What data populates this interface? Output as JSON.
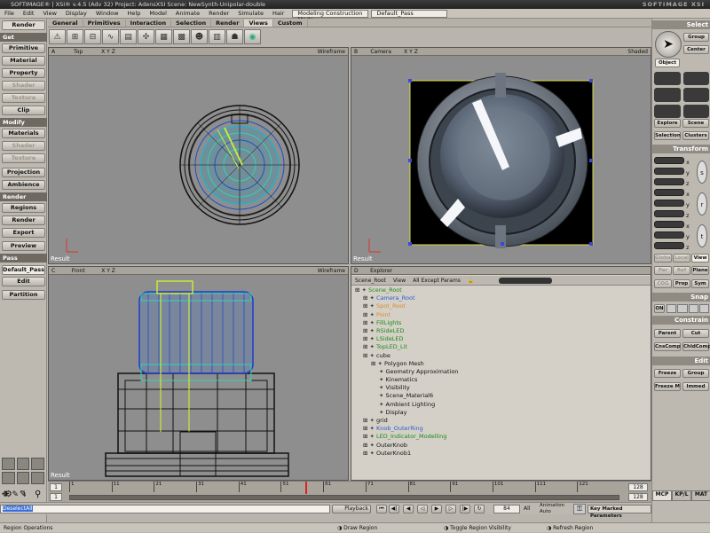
{
  "titlebar": {
    "title": "SOFTIMAGE® | XSI® v.4.5 (Adv 32) Project: AdensXSI    Scene: NewSynth-Unipolar-double",
    "logo": "SOFTIMAGE XSI"
  },
  "menu": {
    "items": [
      "File",
      "Edit",
      "View",
      "Display",
      "Window",
      "Help",
      "Model",
      "Animate",
      "Render",
      "Simulate",
      "Hair"
    ],
    "mode": "Modeling Construction Mode",
    "pass": "Default_Pass"
  },
  "tabs": {
    "items": [
      "General",
      "Primitives",
      "Interaction",
      "Selection",
      "Render",
      "Views",
      "Custom"
    ],
    "active": 5
  },
  "left": {
    "mode": "Render",
    "sections": {
      "get": "Get",
      "modify": "Modify",
      "render": "Render",
      "pass": "Pass"
    },
    "buttons": {
      "primitive": "Primitive",
      "material": "Material",
      "property": "Property",
      "shader": "Shader",
      "texture": "Texture",
      "clip": "Clip",
      "materials": "Materials",
      "mshader": "Shader",
      "mtexture": "Texture",
      "projection": "Projection",
      "ambience": "Ambience",
      "regions": "Regions",
      "render": "Render",
      "export": "Export",
      "preview": "Preview",
      "pass_name": "Default_Pass",
      "edit": "Edit",
      "partition": "Partition"
    }
  },
  "viewports": {
    "a": {
      "letter": "A",
      "view": "Top",
      "xyz": "X Y Z",
      "mode": "Wireframe",
      "name": "Result"
    },
    "b": {
      "letter": "B",
      "view": "Camera",
      "xyz": "X Y Z",
      "mode": "Shaded",
      "name": "Result"
    },
    "c": {
      "letter": "C",
      "view": "Front",
      "xyz": "X Y Z",
      "mode": "Wireframe",
      "name": "Result"
    },
    "d": {
      "letter": "D",
      "view": "Explorer"
    }
  },
  "explorer": {
    "scope": "Scene_Root",
    "view": "View",
    "filter": "All Except Params",
    "tree": [
      {
        "label": "Scene_Root",
        "indent": 0,
        "color": "#1a8a1a"
      },
      {
        "label": "Camera_Root",
        "indent": 1,
        "color": "#2a5bd0"
      },
      {
        "label": "Spot_Root",
        "indent": 1,
        "color": "#d98a2a"
      },
      {
        "label": "Point",
        "indent": 1,
        "color": "#d98a2a"
      },
      {
        "label": "FillLights",
        "indent": 1,
        "color": "#1a8a1a"
      },
      {
        "label": "RSideLED",
        "indent": 1,
        "color": "#1a8a1a"
      },
      {
        "label": "LSideLED",
        "indent": 1,
        "color": "#1a8a1a"
      },
      {
        "label": "TopLED_Lit",
        "indent": 1,
        "color": "#1a8a1a"
      },
      {
        "label": "cube",
        "indent": 1,
        "color": "#111111"
      },
      {
        "label": "Polygon Mesh",
        "indent": 2,
        "color": "#111111"
      },
      {
        "label": "Geometry Approximation",
        "indent": 3,
        "color": "#111111"
      },
      {
        "label": "Kinematics",
        "indent": 3,
        "color": "#111111"
      },
      {
        "label": "Visibility",
        "indent": 3,
        "color": "#111111"
      },
      {
        "label": "Scene_Material6",
        "indent": 3,
        "color": "#111111"
      },
      {
        "label": "Ambient Lighting",
        "indent": 3,
        "color": "#111111"
      },
      {
        "label": "Display",
        "indent": 3,
        "color": "#111111"
      },
      {
        "label": "grid",
        "indent": 1,
        "color": "#111111"
      },
      {
        "label": "Knob_OuterRing",
        "indent": 1,
        "color": "#2a5bd0"
      },
      {
        "label": "LED_Indicator_Modelling",
        "indent": 1,
        "color": "#1a8a1a"
      },
      {
        "label": "OuterKnob",
        "indent": 1,
        "color": "#111111"
      },
      {
        "label": "OuterKnob1",
        "indent": 1,
        "color": "#111111"
      }
    ]
  },
  "right": {
    "select": "Select",
    "group": "Group",
    "center": "Center",
    "object": "Object",
    "explore": "Explore",
    "scene": "Scene",
    "selection": "Selection",
    "clusters": "Clusters",
    "transform": "Transform",
    "x": "x",
    "y": "y",
    "z": "z",
    "global": "Global",
    "local": "Local",
    "view": "View",
    "par": "Par",
    "ref": "Ref",
    "plane": "Plane",
    "cog": "COG",
    "prop": "Prop",
    "sym": "Sym",
    "snap": "Snap",
    "on": "ON",
    "constrain": "Constrain",
    "parent": "Parent",
    "cut": "Cut",
    "cnscomp": "CnsComp",
    "childcomp": "ChldComp",
    "edit": "Edit",
    "freeze": "Freeze",
    "egroup": "Group",
    "freezem": "Freeze M",
    "immed": "Immed",
    "tabs": [
      "MCP",
      "KP/L",
      "MAT"
    ]
  },
  "timeline": {
    "start": "1",
    "end": "128",
    "end2": "128",
    "current": "1",
    "ticks": [
      "1",
      "11",
      "21",
      "31",
      "41",
      "51",
      "61",
      "71",
      "81",
      "91",
      "101",
      "111",
      "121"
    ]
  },
  "playback": {
    "command": "DeselectAll",
    "playback": "Playback",
    "frame": "84",
    "all": "All",
    "animation": "Animation",
    "auto": "Auto",
    "key_marked": "Key Marked Parameters"
  },
  "status": {
    "left": "Region Operations",
    "m1": "Draw Region",
    "m2": "Toggle Region Visibility",
    "m3": "Refresh Region"
  }
}
